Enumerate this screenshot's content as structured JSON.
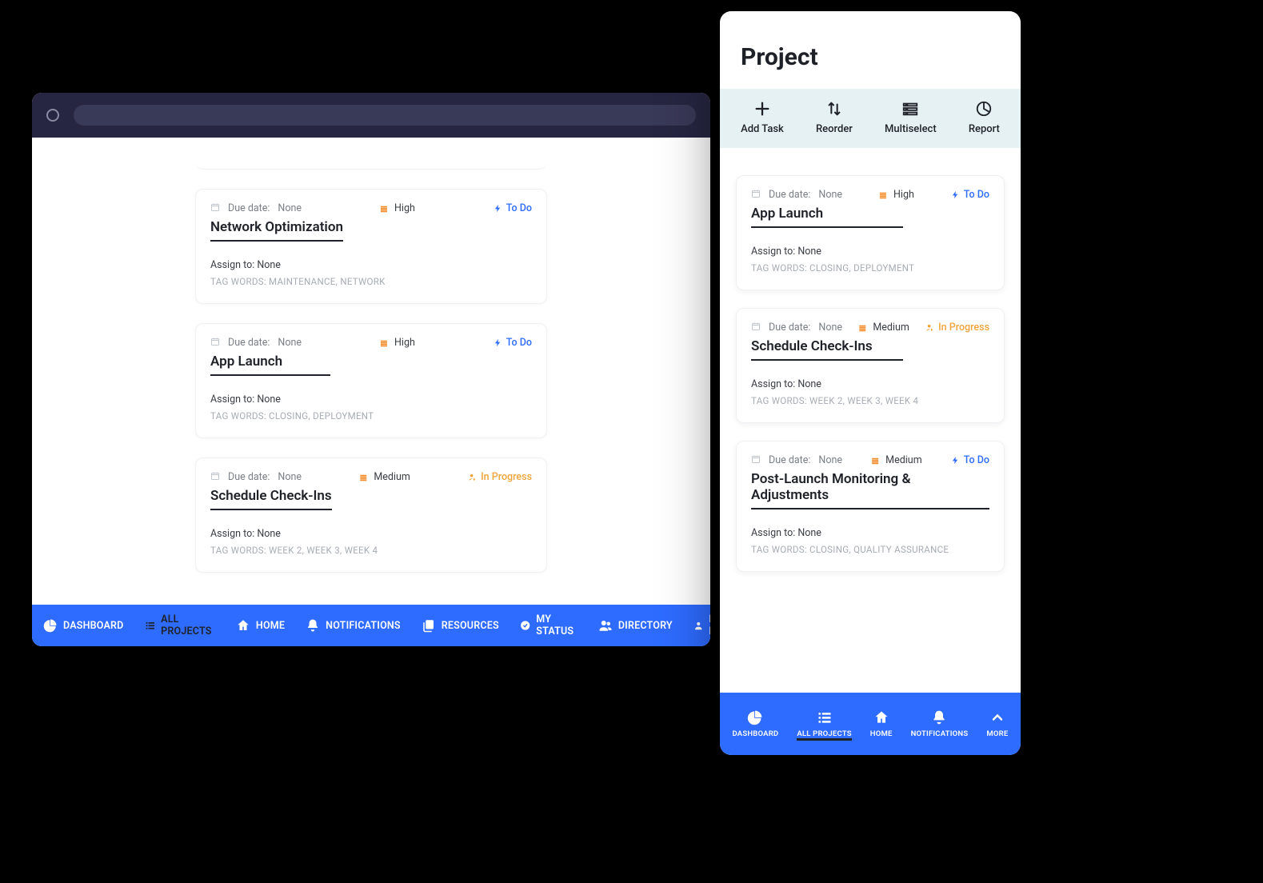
{
  "desktop": {
    "partial_card_visible": true,
    "tasks": [
      {
        "due_label": "Due date:",
        "due_value": "None",
        "priority": "High",
        "status": "To Do",
        "status_kind": "todo",
        "title": "Network Optimization",
        "assign_label": "Assign to:",
        "assign_value": "None",
        "tags_label": "TAG WORDS:",
        "tags_value": "MAINTENANCE, NETWORK"
      },
      {
        "due_label": "Due date:",
        "due_value": "None",
        "priority": "High",
        "status": "To Do",
        "status_kind": "todo",
        "title": "App Launch",
        "assign_label": "Assign to:",
        "assign_value": "None",
        "tags_label": "TAG WORDS:",
        "tags_value": "CLOSING, DEPLOYMENT"
      },
      {
        "due_label": "Due date:",
        "due_value": "None",
        "priority": "Medium",
        "status": "In Progress",
        "status_kind": "progress",
        "title": "Schedule Check-Ins",
        "assign_label": "Assign to:",
        "assign_value": "None",
        "tags_label": "TAG WORDS:",
        "tags_value": "WEEK 2, WEEK 3, WEEK 4"
      }
    ],
    "nav": [
      {
        "label": "DASHBOARD",
        "icon": "chart-pie"
      },
      {
        "label": "ALL PROJECTS",
        "icon": "list",
        "active": true
      },
      {
        "label": "HOME",
        "icon": "home"
      },
      {
        "label": "NOTIFICATIONS",
        "icon": "bell"
      },
      {
        "label": "RESOURCES",
        "icon": "copy"
      },
      {
        "label": "MY STATUS",
        "icon": "check-circle"
      },
      {
        "label": "DIRECTORY",
        "icon": "users"
      },
      {
        "label": "EDIT PROFILE",
        "icon": "user"
      }
    ]
  },
  "mobile": {
    "header_title": "Project",
    "actions": [
      {
        "label": "Add Task",
        "icon": "plus"
      },
      {
        "label": "Reorder",
        "icon": "updown"
      },
      {
        "label": "Multiselect",
        "icon": "list"
      },
      {
        "label": "Report",
        "icon": "pie"
      }
    ],
    "tasks": [
      {
        "due_label": "Due date:",
        "due_value": "None",
        "priority": "High",
        "status": "To Do",
        "status_kind": "todo",
        "title": "App Launch",
        "assign_label": "Assign to:",
        "assign_value": "None",
        "tags_label": "TAG WORDS:",
        "tags_value": "CLOSING, DEPLOYMENT"
      },
      {
        "due_label": "Due date:",
        "due_value": "None",
        "priority": "Medium",
        "status": "In Progress",
        "status_kind": "progress",
        "title": "Schedule Check-Ins",
        "assign_label": "Assign to:",
        "assign_value": "None",
        "tags_label": "TAG WORDS:",
        "tags_value": "WEEK 2, WEEK 3, WEEK 4"
      },
      {
        "due_label": "Due date:",
        "due_value": "None",
        "priority": "Medium",
        "status": "To Do",
        "status_kind": "todo",
        "title": "Post-Launch Monitoring & Adjustments",
        "assign_label": "Assign to:",
        "assign_value": "None",
        "tags_label": "TAG WORDS:",
        "tags_value": "CLOSING, QUALITY ASSURANCE"
      }
    ],
    "nav": [
      {
        "label": "DASHBOARD",
        "icon": "chart-pie"
      },
      {
        "label": "ALL PROJECTS",
        "icon": "list",
        "active": true
      },
      {
        "label": "HOME",
        "icon": "home"
      },
      {
        "label": "NOTIFICATIONS",
        "icon": "bell"
      },
      {
        "label": "MORE",
        "icon": "chevron-up"
      }
    ]
  },
  "colors": {
    "accent": "#2E6BFF",
    "priority": "#F58B28",
    "progress": "#F1A43C",
    "text": "#1F2128"
  }
}
